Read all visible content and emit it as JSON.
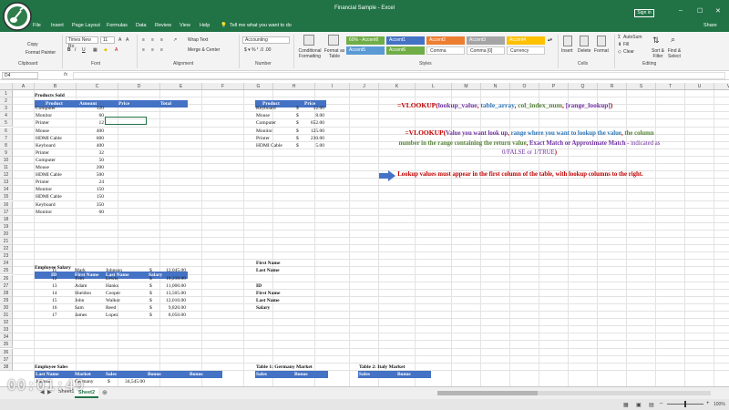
{
  "window": {
    "title": "Financial Sample - Excel",
    "sign_in": "Sign in",
    "share": "Share",
    "tell_me": "Tell me what you want to do"
  },
  "menu_tabs": [
    "File",
    "Insert",
    "Page Layout",
    "Formulas",
    "Data",
    "Review",
    "View",
    "Help"
  ],
  "ribbon": {
    "clipboard": {
      "copy": "Copy",
      "format_painter": "Format Painter",
      "label": "Clipboard"
    },
    "font": {
      "name": "Times New Ro",
      "size": "11",
      "label": "Font"
    },
    "alignment": {
      "wrap": "Wrap Text",
      "merge": "Merge & Center",
      "label": "Alignment"
    },
    "number": {
      "format": "Accounting",
      "label": "Number"
    },
    "styles": {
      "conditional": "Conditional Formatting",
      "format_table": "Format as Table",
      "cells": [
        {
          "text": "60% - Accent6",
          "color": "#70ad47"
        },
        {
          "text": "Accent1",
          "color": "#4472c4"
        },
        {
          "text": "Accent2",
          "color": "#ed7d31"
        },
        {
          "text": "Accent3",
          "color": "#a5a5a5"
        },
        {
          "text": "Accent4",
          "color": "#ffc000"
        },
        {
          "text": "Accent5",
          "color": "#5b9bd5"
        },
        {
          "text": "Accent6",
          "color": "#70ad47"
        },
        {
          "text": "Comma",
          "color": "#ffffff"
        },
        {
          "text": "Comma [0]",
          "color": "#ffffff"
        },
        {
          "text": "Currency",
          "color": "#ffffff"
        }
      ],
      "label": "Styles"
    },
    "cells": {
      "insert": "Insert",
      "delete": "Delete",
      "format": "Format",
      "label": "Cells"
    },
    "editing": {
      "autosum": "AutoSum",
      "fill": "Fill",
      "clear": "Clear",
      "sort": "Sort & Filter",
      "find": "Find & Select",
      "label": "Editing"
    }
  },
  "formula_bar": {
    "name_box": "D4",
    "fx": "fx"
  },
  "columns": [
    "A",
    "B",
    "C",
    "D",
    "E",
    "F",
    "G",
    "H",
    "I",
    "J",
    "K",
    "L",
    "M",
    "N",
    "O",
    "P",
    "Q",
    "R",
    "S",
    "T",
    "U",
    "V",
    "W"
  ],
  "rows": [
    "1",
    "2",
    "3",
    "4",
    "5",
    "6",
    "7",
    "8",
    "9",
    "10",
    "11",
    "12",
    "13",
    "14",
    "15",
    "16",
    "17",
    "18",
    "19",
    "20",
    "21",
    "22",
    "23",
    "24",
    "25",
    "26",
    "27",
    "28",
    "29",
    "30",
    "31",
    "32",
    "33",
    "34",
    "35",
    "36",
    "37",
    "38"
  ],
  "products_sold": {
    "title": "Products Sold",
    "headers": [
      "Product",
      "Amount",
      "Price",
      "Total"
    ],
    "rows": [
      [
        "Computer",
        "120"
      ],
      [
        "Monitor",
        "60"
      ],
      [
        "Printer",
        "12"
      ],
      [
        "Mouse",
        "400"
      ],
      [
        "HDMI Cable",
        "600"
      ],
      [
        "Keyboard",
        "400"
      ],
      [
        "Printer",
        "32"
      ],
      [
        "Computer",
        "50"
      ],
      [
        "Mouse",
        "200"
      ],
      [
        "HDMI Cable",
        "500"
      ],
      [
        "Printer",
        "24"
      ],
      [
        "Monitor",
        "150"
      ],
      [
        "HDMI Cable",
        "150"
      ],
      [
        "Keyboard",
        "350"
      ],
      [
        "Monitor",
        "60"
      ]
    ]
  },
  "price_table": {
    "headers": [
      "Product",
      "Price"
    ],
    "rows": [
      [
        "Keyboard",
        "$",
        "12.00"
      ],
      [
        "Mouse",
        "$",
        "8.00"
      ],
      [
        "Computer",
        "$",
        "652.00"
      ],
      [
        "Monitor",
        "$",
        "125.00"
      ],
      [
        "Printer",
        "$",
        "230.00"
      ],
      [
        "HDMI Cable",
        "$",
        "5.00"
      ]
    ]
  },
  "notes": {
    "syntax": {
      "fn": "=VLOOKUP(",
      "a1": "lookup_value",
      "c1": ", ",
      "a2": "table_array",
      "c2": ", ",
      "a3": "col_index_num",
      "c3": ", ",
      "a4": "[range_lookup]",
      "end": ")"
    },
    "explain": {
      "p1": "=VLOOKUP(",
      "p2": "Value you want look up",
      "p3": ", ",
      "p4": "range where you want to lookup the value",
      "p5": ", ",
      "p6": "the column number in the range containing the return value",
      "p7": ", ",
      "p8": "Exact Match or Approximate Match",
      "p9": " - indicated as 0/FALSE or 1/TRUE",
      "p10": ")"
    },
    "tip": "Lookup values must appear in the first column of the table, with lookup columns to the right."
  },
  "employee_salary": {
    "title": "Employee Salary",
    "headers": [
      "ID",
      "First Name",
      "Last Name",
      "Salary"
    ],
    "rows": [
      [
        "11",
        "Mark",
        "Johnson",
        "$",
        "12,045.00"
      ],
      [
        "12",
        "Tom",
        "Lewis",
        "$",
        "10,210.00"
      ],
      [
        "13",
        "Adam",
        "Hanks",
        "$",
        "11,000.00"
      ],
      [
        "14",
        "Sheldon",
        "Cooper",
        "$",
        "13,505.00"
      ],
      [
        "15",
        "John",
        "Walkor",
        "$",
        "12,010.00"
      ],
      [
        "16",
        "Sam",
        "Reed",
        "$",
        "9,820.00"
      ],
      [
        "17",
        "James",
        "Lopez",
        "$",
        "8,050.00"
      ]
    ]
  },
  "lookup_labels": [
    "First Name",
    "Last Name",
    "ID",
    "First Name",
    "Last Name",
    "Salary"
  ],
  "employee_sales": {
    "title": "Employee Sales",
    "headers": [
      "Last Name",
      "Market",
      "Sales",
      "Bonus",
      "Bonus"
    ],
    "row1": [
      "Johnson",
      "Germany",
      "$",
      "34,545.00"
    ]
  },
  "germany": {
    "title": "Table 1: Germany Market",
    "headers": [
      "Sales",
      "Bonus"
    ]
  },
  "italy": {
    "title": "Table 2: Italy Market",
    "headers": [
      "Sales",
      "Bonus"
    ]
  },
  "sheet_tabs": [
    "Sheet1",
    "Sheet2"
  ],
  "zoom": "100%",
  "video_timer": "00:01:49"
}
